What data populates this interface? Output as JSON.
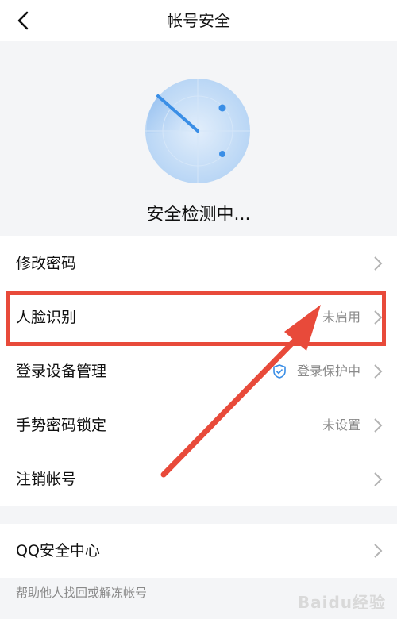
{
  "header": {
    "title": "帐号安全"
  },
  "hero": {
    "status_text": "安全检测中..."
  },
  "menu": [
    {
      "label": "修改密码",
      "value": ""
    },
    {
      "label": "人脸识别",
      "value": "未启用"
    },
    {
      "label": "登录设备管理",
      "value": "登录保护中"
    },
    {
      "label": "手势密码锁定",
      "value": "未设置"
    },
    {
      "label": "注销帐号",
      "value": ""
    }
  ],
  "security_center": {
    "label": "QQ安全中心",
    "help": "帮助他人找回或解冻帐号"
  },
  "watermark": {
    "text": "Baidu经验"
  },
  "colors": {
    "annotation": "#e84a3a",
    "accent": "#3a8ee6"
  },
  "icons": [
    "back-icon",
    "radar-icon",
    "chevron-right-icon",
    "shield-check-icon"
  ]
}
